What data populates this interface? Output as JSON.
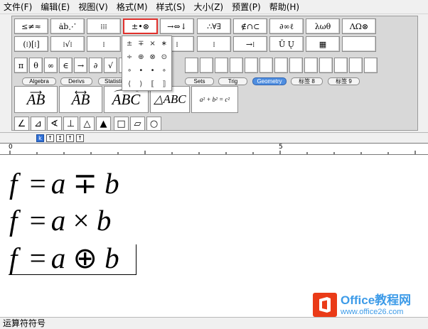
{
  "menu": [
    "文件(F)",
    "编辑(E)",
    "视图(V)",
    "格式(M)",
    "样式(S)",
    "大小(Z)",
    "预置(P)",
    "帮助(H)"
  ],
  "palette_row1": [
    "≤≠≈",
    "ȧb⋰",
    "⁞⁞⁞",
    "±•⊗",
    "→⇔↓",
    "∴∀∃",
    "∉∩⊂",
    "∂∞ℓ",
    "λωθ",
    "ΛΩ⊗"
  ],
  "palette_row2": [
    "(⁞)[⁞]",
    "⁞√⁞",
    "⁞",
    "⁞",
    "⁞",
    "→⁞",
    "Ū Ų",
    "▦"
  ],
  "palette_row3": [
    "π",
    "θ",
    "∞",
    "∈",
    "→",
    "∂",
    "√"
  ],
  "tabs": [
    "Algebra",
    "Derivs",
    "Statistics",
    "Sets",
    "Trig",
    "Geometry",
    "标签 8",
    "标签 9"
  ],
  "active_tab": "Geometry",
  "templates": [
    "AB",
    "AB",
    "ABC",
    "△ABC",
    "a² + b² = c²"
  ],
  "shapes": [
    "∠",
    "⊿",
    "∢",
    "⊥",
    "△",
    "▲",
    "□",
    "▱",
    "○"
  ],
  "dropdown": [
    "±",
    "∓",
    "×",
    "∗",
    "÷",
    "⊕",
    "⊗",
    "⊙",
    "∘",
    "•",
    "•",
    "∘",
    "⟨",
    "⟩",
    "⟦",
    "⟧"
  ],
  "size_buttons": [
    "k",
    "↑",
    "↥",
    "↑",
    "↑"
  ],
  "ruler": {
    "label0": "0",
    "label5": "5"
  },
  "equations": [
    {
      "lhs": "f",
      "eq": "=",
      "a": "a",
      "op": "∓",
      "b": "b"
    },
    {
      "lhs": "f",
      "eq": "=",
      "a": "a",
      "op": "×",
      "b": "b"
    },
    {
      "lhs": "f",
      "eq": "=",
      "a": "a",
      "op": "⊕",
      "b": "b"
    }
  ],
  "watermark": {
    "title": "Office教程网",
    "url": "www.office26.com"
  },
  "status": "运算符符号"
}
